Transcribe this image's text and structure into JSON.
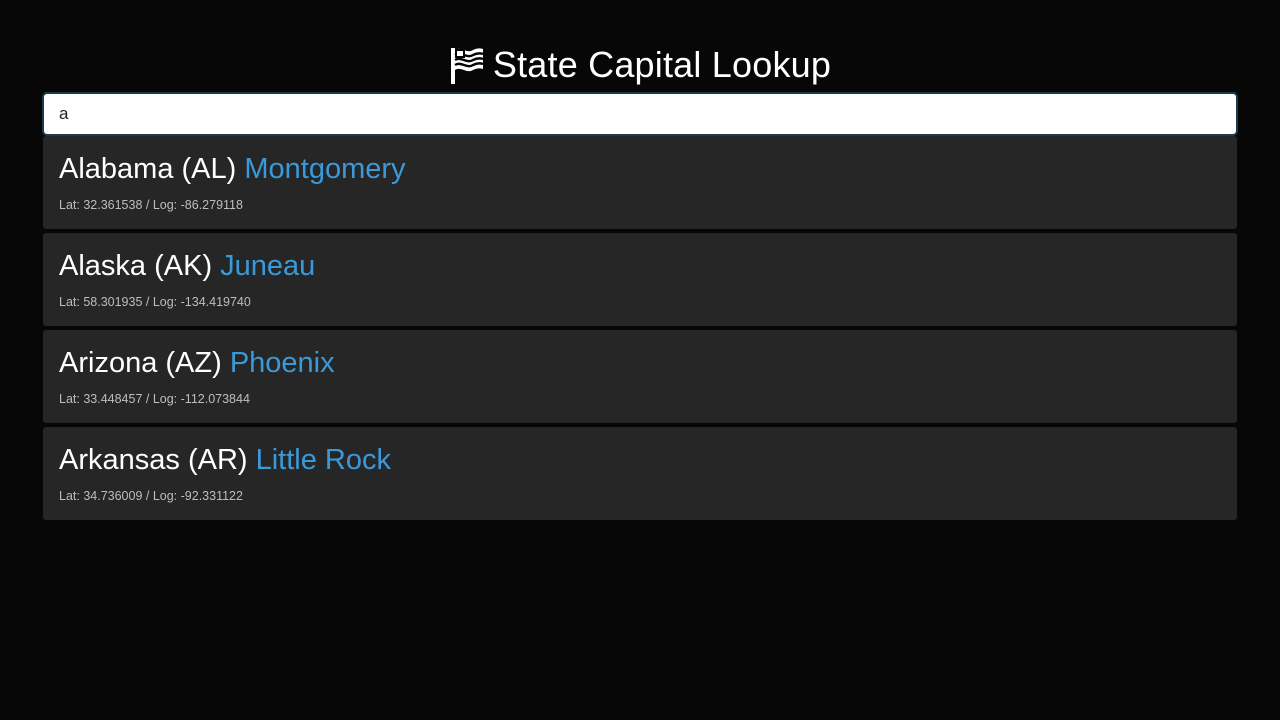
{
  "header": {
    "title": "State Capital Lookup",
    "icon": "flag-icon"
  },
  "search": {
    "value": "a",
    "placeholder": ""
  },
  "results": [
    {
      "state_label": "Alabama (AL)",
      "capital": "Montgomery",
      "coords": "Lat: 32.361538 / Log: -86.279118"
    },
    {
      "state_label": "Alaska (AK)",
      "capital": "Juneau",
      "coords": "Lat: 58.301935 / Log: -134.419740"
    },
    {
      "state_label": "Arizona (AZ)",
      "capital": "Phoenix",
      "coords": "Lat: 33.448457 / Log: -112.073844"
    },
    {
      "state_label": "Arkansas (AR)",
      "capital": "Little Rock",
      "coords": "Lat: 34.736009 / Log: -92.331122"
    }
  ],
  "colors": {
    "background": "#070707",
    "card": "#262626",
    "accent": "#3a9ad9",
    "text": "#ffffff",
    "muted": "#bdbdbd"
  }
}
